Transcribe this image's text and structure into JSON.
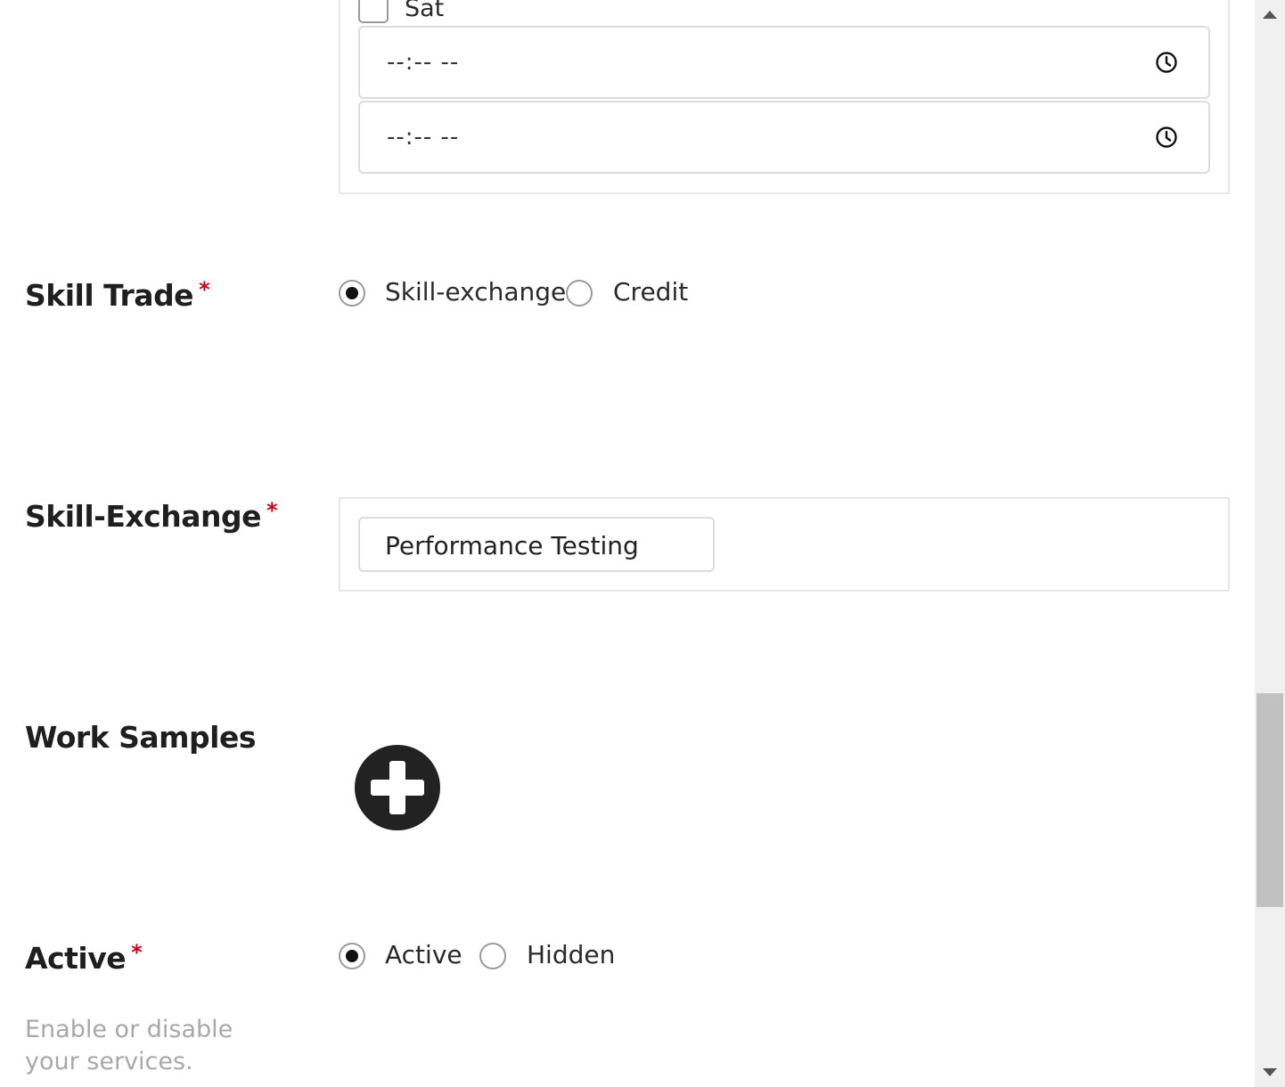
{
  "availability": {
    "day_label": "Sat",
    "start_time": {
      "value": "--:-- --"
    },
    "end_time": {
      "value": "--:-- --"
    }
  },
  "skill_trade": {
    "label": "Skill Trade",
    "required_mark": "*",
    "options": [
      {
        "label": "Skill-exchange",
        "selected": true
      },
      {
        "label": "Credit",
        "selected": false
      }
    ]
  },
  "skill_exchange": {
    "label": "Skill-Exchange",
    "required_mark": "*",
    "value": "Performance Testing"
  },
  "work_samples": {
    "label": "Work Samples",
    "add_icon": "plus-circle-icon"
  },
  "active": {
    "label": "Active",
    "required_mark": "*",
    "help_text": "Enable or disable your services.",
    "help_lines": [
      "Enable or disable",
      "your services."
    ],
    "options": [
      {
        "label": "Active",
        "selected": true
      },
      {
        "label": "Hidden",
        "selected": false
      }
    ]
  },
  "colors": {
    "required": "#d0021b",
    "border": "#dcdcdc",
    "help_text": "#a8a8a8"
  }
}
